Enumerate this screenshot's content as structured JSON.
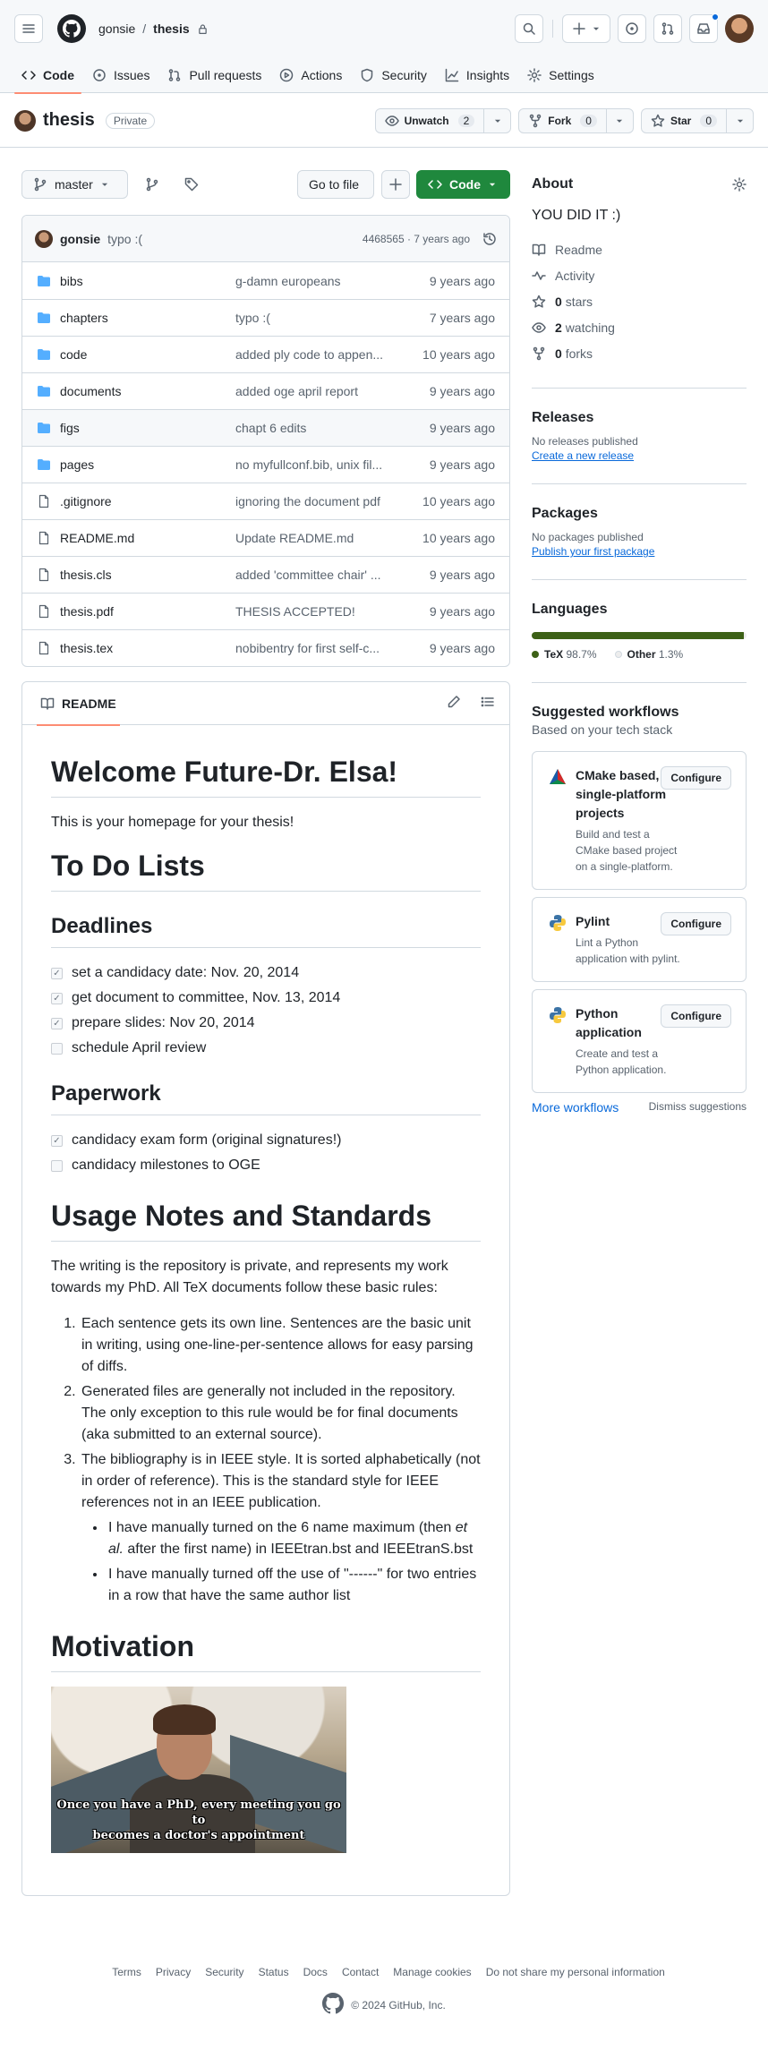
{
  "header": {
    "owner": "gonsie",
    "separator": "/",
    "repo": "thesis"
  },
  "tabs": [
    {
      "label": "Code"
    },
    {
      "label": "Issues"
    },
    {
      "label": "Pull requests"
    },
    {
      "label": "Actions"
    },
    {
      "label": "Security"
    },
    {
      "label": "Insights"
    },
    {
      "label": "Settings"
    }
  ],
  "repo": {
    "name": "thesis",
    "visibility": "Private",
    "unwatch_label": "Unwatch",
    "watch_count": "2",
    "fork_label": "Fork",
    "fork_count": "0",
    "star_label": "Star",
    "star_count": "0"
  },
  "controls": {
    "branch": "master",
    "go_to_file": "Go to file",
    "code": "Code"
  },
  "commit": {
    "author": "gonsie",
    "message": "typo :(",
    "meta": "4468565 · 7 years ago"
  },
  "files": [
    {
      "name": "bibs",
      "type": "dir",
      "message": "g-damn europeans",
      "age": "9 years ago"
    },
    {
      "name": "chapters",
      "type": "dir",
      "message": "typo :(",
      "age": "7 years ago"
    },
    {
      "name": "code",
      "type": "dir",
      "message": "added ply code to appen...",
      "age": "10 years ago"
    },
    {
      "name": "documents",
      "type": "dir",
      "message": "added oge april report",
      "age": "9 years ago"
    },
    {
      "name": "figs",
      "type": "dir",
      "message": "chapt 6 edits",
      "age": "9 years ago"
    },
    {
      "name": "pages",
      "type": "dir",
      "message": "no myfullconf.bib, unix fil...",
      "age": "9 years ago"
    },
    {
      "name": ".gitignore",
      "type": "file",
      "message": "ignoring the document pdf",
      "age": "10 years ago"
    },
    {
      "name": "README.md",
      "type": "file",
      "message": "Update README.md",
      "age": "10 years ago"
    },
    {
      "name": "thesis.cls",
      "type": "file",
      "message": "added 'committee chair' ...",
      "age": "9 years ago"
    },
    {
      "name": "thesis.pdf",
      "type": "file",
      "message": "THESIS ACCEPTED!",
      "age": "9 years ago"
    },
    {
      "name": "thesis.tex",
      "type": "file",
      "message": "nobibentry for first self-c...",
      "age": "9 years ago"
    }
  ],
  "readme": {
    "tab_label": "README",
    "h1": "Welcome Future-Dr. Elsa!",
    "intro": "This is your homepage for your thesis!",
    "todo_title": "To Do Lists",
    "deadlines_title": "Deadlines",
    "deadlines": [
      {
        "text": "set a candidacy date: Nov. 20, 2014",
        "checked": true
      },
      {
        "text": "get document to committee, Nov. 13, 2014",
        "checked": true
      },
      {
        "text": "prepare slides: Nov 20, 2014",
        "checked": true
      },
      {
        "text": "schedule April review",
        "checked": false
      }
    ],
    "paperwork_title": "Paperwork",
    "paperwork": [
      {
        "text": "candidacy exam form (original signatures!)",
        "checked": true
      },
      {
        "text": "candidacy milestones to OGE",
        "checked": false
      }
    ],
    "usage_title": "Usage Notes and Standards",
    "usage_intro": "The writing is the repository is private, and represents my work towards my PhD. All TeX documents follow these basic rules:",
    "rules": [
      "Each sentence gets its own line. Sentences are the basic unit in writing, using one-line-per-sentence allows for easy parsing of diffs.",
      "Generated files are generally not included in the repository. The only exception to this rule would be for final documents (aka submitted to an external source).",
      "The bibliography is in IEEE style. It is sorted alphabetically (not in order of reference). This is the standard style for IEEE references not in an IEEE publication."
    ],
    "subrule1_a": "I have manually turned on the 6 name maximum (then ",
    "subrule1_em": "et al.",
    "subrule1_b": " after the first name) in IEEEtran.bst and IEEEtranS.bst",
    "subrule2": "I have manually turned off the use of \"------\" for two entries in a row that have the same author list",
    "motivation_title": "Motivation",
    "meme_caption_1": "Once you have a PhD, every meeting you go to",
    "meme_caption_2": "becomes a doctor's appointment"
  },
  "about": {
    "title": "About",
    "description": "YOU DID IT :)",
    "readme": "Readme",
    "activity": "Activity",
    "stars_count": "0",
    "stars_label": "stars",
    "watching_count": "2",
    "watching_label": "watching",
    "forks_count": "0",
    "forks_label": "forks"
  },
  "releases": {
    "title": "Releases",
    "empty": "No releases published",
    "link": "Create a new release"
  },
  "packages": {
    "title": "Packages",
    "empty": "No packages published",
    "link": "Publish your first package"
  },
  "languages": {
    "title": "Languages",
    "items": [
      {
        "name": "TeX",
        "percent": "98.7%",
        "value": 98.7,
        "color": "#3D6117"
      },
      {
        "name": "Other",
        "percent": "1.3%",
        "value": 1.3,
        "color": "#ededed"
      }
    ]
  },
  "workflows": {
    "title": "Suggested workflows",
    "subtitle": "Based on your tech stack",
    "configure_label": "Configure",
    "items": [
      {
        "title": "CMake based, single-platform projects",
        "desc": "Build and test a CMake based project on a single-platform."
      },
      {
        "title": "Pylint",
        "desc": "Lint a Python application with pylint."
      },
      {
        "title": "Python application",
        "desc": "Create and test a Python application."
      }
    ],
    "more": "More workflows",
    "dismiss": "Dismiss suggestions"
  },
  "footer": {
    "links": [
      "Terms",
      "Privacy",
      "Security",
      "Status",
      "Docs",
      "Contact",
      "Manage cookies",
      "Do not share my personal information"
    ],
    "copyright": "© 2024 GitHub, Inc."
  }
}
